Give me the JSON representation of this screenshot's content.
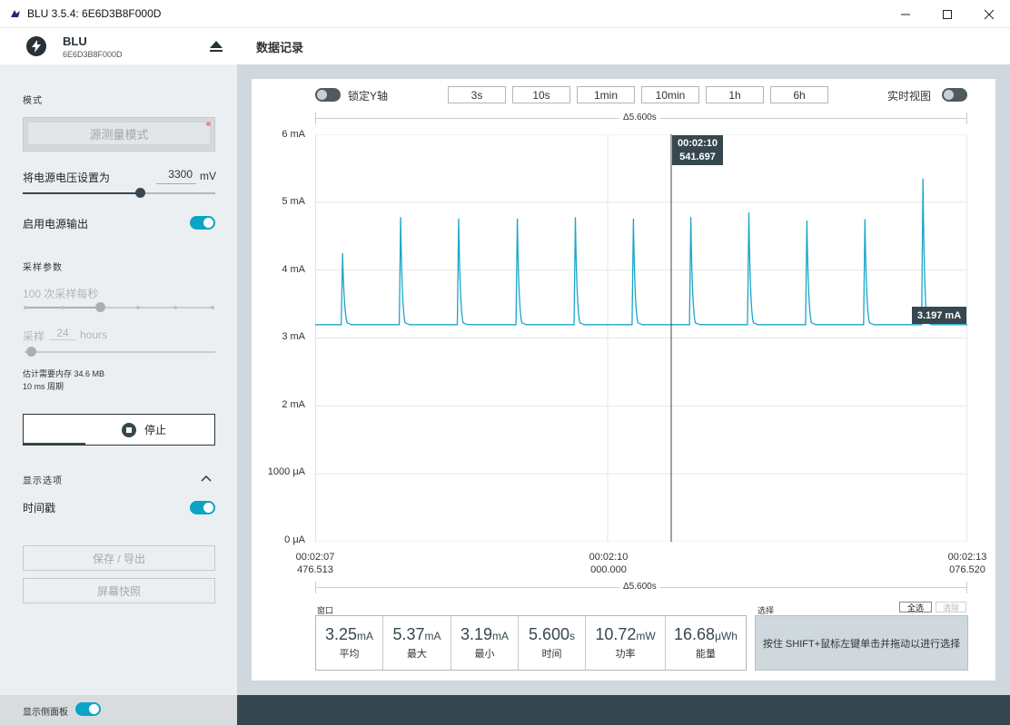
{
  "window": {
    "title": "BLU 3.5.4: 6E6D3B8F000D"
  },
  "device": {
    "name": "BLU",
    "id": "6E6D3B8F000D"
  },
  "page": {
    "title": "数据记录"
  },
  "sidebar": {
    "mode_label": "模式",
    "mode_button": "源测量模式",
    "voltage_label": "将电源电压设置为",
    "voltage_value": "3300",
    "voltage_unit": "mV",
    "power_output_label": "启用电源输出",
    "sampling_label": "采样参数",
    "sample_rate_text": "100 次采样每秒",
    "sample_label": "采样",
    "sample_value": "24",
    "sample_unit": "hours",
    "memory_info": "估计需要内存 34.6 MB",
    "period_info": "10 ms 周期",
    "stop_button": "停止",
    "display_options_label": "显示选项",
    "timestamp_label": "时间戳",
    "save_export_button": "保存 / 导出",
    "screenshot_button": "屏幕快照",
    "show_sidebar_label": "显示侧面板"
  },
  "toolbar": {
    "lock_y_label": "锁定Y轴",
    "ranges": [
      "3s",
      "10s",
      "1min",
      "10min",
      "1h",
      "6h"
    ],
    "live_view_label": "实时视图"
  },
  "chart_data": {
    "type": "line",
    "delta_top": "Δ5.600s",
    "delta_bottom": "Δ5.600s",
    "y_ticks": [
      "6 mA",
      "5 mA",
      "4 mA",
      "3 mA",
      "2 mA",
      "1000 μA",
      "0 μA"
    ],
    "ylim": [
      0,
      6
    ],
    "x_ticks": [
      {
        "time": "00:02:07",
        "sub": "476.513"
      },
      {
        "time": "00:02:10",
        "sub": "000.000"
      },
      {
        "time": "00:02:13",
        "sub": "076.520"
      }
    ],
    "baseline_ma": 3.197,
    "peaks": [
      {
        "t": 0.042,
        "ma": 4.25
      },
      {
        "t": 0.131,
        "ma": 4.78
      },
      {
        "t": 0.22,
        "ma": 4.76
      },
      {
        "t": 0.31,
        "ma": 4.76
      },
      {
        "t": 0.399,
        "ma": 4.78
      },
      {
        "t": 0.488,
        "ma": 4.76
      },
      {
        "t": 0.576,
        "ma": 4.78
      },
      {
        "t": 0.665,
        "ma": 4.85
      },
      {
        "t": 0.754,
        "ma": 4.73
      },
      {
        "t": 0.843,
        "ma": 4.75
      },
      {
        "t": 0.932,
        "ma": 5.35
      }
    ],
    "cursor_time": "00:02:10",
    "cursor_value": "541.697",
    "last_value": "3.197 mA",
    "line_color": "#1aa6c8"
  },
  "stats": {
    "window_label": "窗口",
    "items": [
      {
        "value": "3.25",
        "unit": "mA",
        "name": "平均"
      },
      {
        "value": "5.37",
        "unit": "mA",
        "name": "最大"
      },
      {
        "value": "3.19",
        "unit": "mA",
        "name": "最小"
      },
      {
        "value": "5.600",
        "unit": "s",
        "name": "时间"
      },
      {
        "value": "10.72",
        "unit": "mW",
        "name": "功率"
      },
      {
        "value": "16.68",
        "unit": "μWh",
        "name": "能量"
      }
    ],
    "selection_label": "选择",
    "select_all_button": "全选",
    "clear_button": "清除",
    "selection_hint": "按住 SHIFT+鼠标左键单击并拖动以进行选择"
  }
}
